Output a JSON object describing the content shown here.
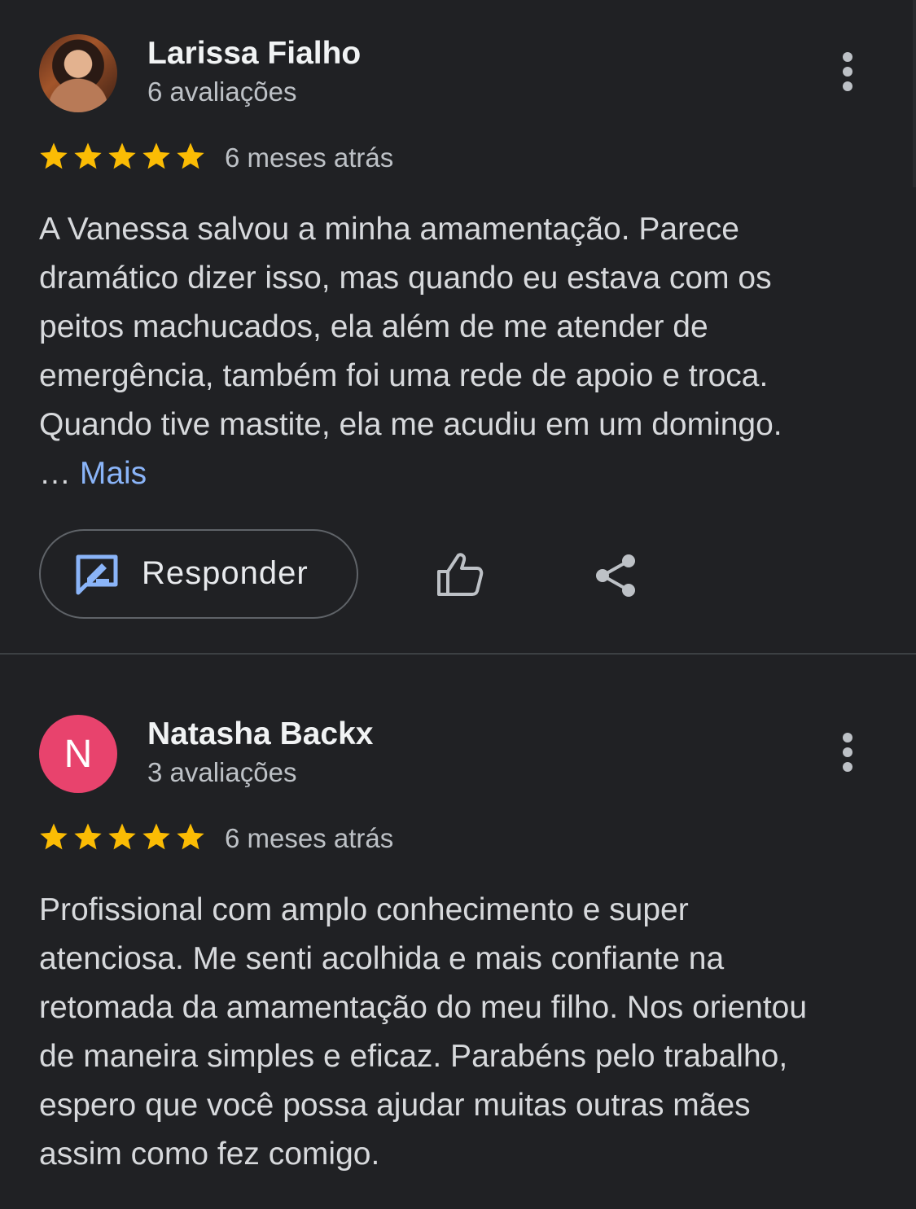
{
  "reviews": [
    {
      "author": "Larissa Fialho",
      "review_count": "6 avaliações",
      "avatar": "photo",
      "rating": 5,
      "date": "6 meses atrás",
      "text_lines": [
        "A Vanessa salvou a minha amamentação. Parece",
        "dramático dizer isso, mas quando eu estava com os",
        "peitos machucados, ela além de me atender de",
        "emergência, também foi uma rede de apoio e troca.",
        "Quando tive mastite, ela me acudiu em um domingo."
      ],
      "ellipsis": "…",
      "more_label": "Mais",
      "reply_label": "Responder"
    },
    {
      "author": "Natasha Backx",
      "review_count": "3 avaliações",
      "avatar_letter": "N",
      "avatar_color": "#e8436d",
      "rating": 5,
      "date": "6 meses atrás",
      "text_lines": [
        "Profissional com amplo conhecimento e super",
        "atenciosa. Me senti acolhida e mais confiante na",
        "retomada da amamentação do meu filho. Nos orientou",
        "de maneira simples e eficaz. Parabéns pelo trabalho,",
        "espero que você possa ajudar muitas outras mães",
        "assim como fez comigo."
      ]
    }
  ],
  "colors": {
    "background": "#202124",
    "star": "#fbbc04",
    "link": "#8ab4f8",
    "divider": "#3c4043"
  },
  "icons": {
    "menu": "more-vertical-icon",
    "reply": "reply-edit-icon",
    "like": "thumbs-up-icon",
    "share": "share-icon",
    "star": "star-icon"
  }
}
